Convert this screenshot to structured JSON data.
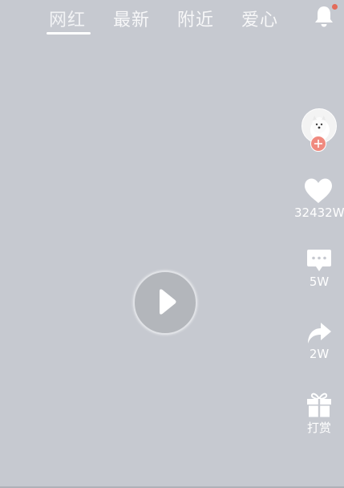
{
  "tabs": [
    {
      "label": "网红",
      "active": true
    },
    {
      "label": "最新",
      "active": false
    },
    {
      "label": "附近",
      "active": false
    },
    {
      "label": "爱心",
      "active": false
    }
  ],
  "notification": {
    "icon": "bell-icon",
    "has_badge": true,
    "badge_color": "#e36b5a"
  },
  "video": {
    "play_icon": "play-icon"
  },
  "actions": {
    "avatar": {
      "icon": "avatar",
      "follow_icon": "plus-icon",
      "follow_color": "#f08a7f"
    },
    "like": {
      "icon": "heart-icon",
      "label": "32432W"
    },
    "comment": {
      "icon": "comment-icon",
      "label": "5W"
    },
    "share": {
      "icon": "share-icon",
      "label": "2W"
    },
    "gift": {
      "icon": "gift-icon",
      "label": "打赏"
    }
  },
  "colors": {
    "background": "#c6c9d0",
    "text": "#ffffff"
  }
}
